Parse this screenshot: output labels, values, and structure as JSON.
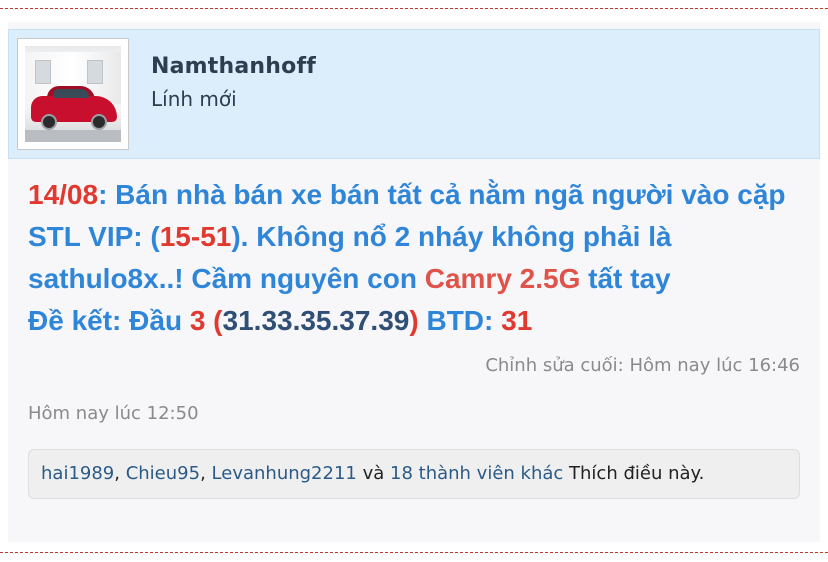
{
  "user": {
    "name": "Namthanhoff",
    "title": "Lính mới",
    "avatar_icon": "avatar-red-car-photo"
  },
  "post": {
    "segments": {
      "date": "14/08",
      "s1": ": Bán nhà bán xe bán tất cả nằm ngã người vào cặp STL VIP: (",
      "pair": "15-51",
      "s2": "). Không nổ 2 nháy không phải là sathulo8x..! Cầm nguyên con ",
      "car": "Camry 2.5G",
      "s3": " tất tay",
      "s4": "Đề kết: Đầu ",
      "head": "3",
      "s5": " (",
      "numbers": "31.33.35.37.39",
      "s6": ")",
      "s7": " BTD: ",
      "btd": "31"
    },
    "edited_label": "Chỉnh sửa cuối: Hôm nay lúc 16:46",
    "posted_at": "Hôm nay lúc 12:50"
  },
  "likes": {
    "user1": "hai1989",
    "sep1": ", ",
    "user2": "Chieu95",
    "sep2": ", ",
    "user3": "Levanhung2211",
    "and": " và ",
    "others": "18 thành viên khác",
    "suffix": " Thích điều này."
  },
  "colors": {
    "accent_blue": "#2f86d8",
    "highlight_red": "#e03a30",
    "numbers_navy": "#2f4f75",
    "header_bg": "#dceefc",
    "divider_dashed": "#c0392b"
  }
}
